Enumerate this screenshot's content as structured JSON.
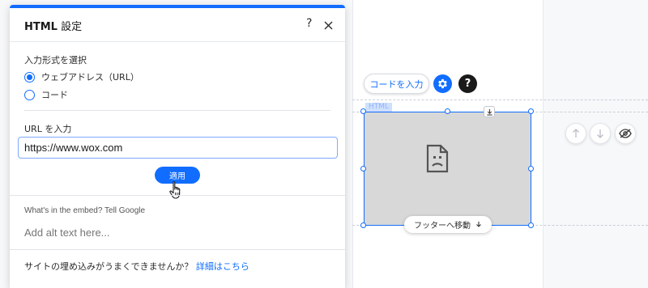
{
  "dialog": {
    "title_bold": "HTML",
    "title_rest": " 設定",
    "help_label": "?",
    "input_type_label": "入力形式を選択",
    "options": [
      {
        "label": "ウェブアドレス（URL）",
        "selected": true
      },
      {
        "label": "コード",
        "selected": false
      }
    ],
    "url_label": "URL を入力",
    "url_value": "https://www.wox.com",
    "apply_label": "適用",
    "alt_prompt": "What's in the embed? Tell Google",
    "alt_placeholder": "Add alt text here...",
    "trouble_text": "サイトの埋め込みがうまくできませんか？",
    "trouble_link": "詳細はこちら"
  },
  "canvas": {
    "code_button_label": "コードを入力",
    "help_label": "?",
    "element_tag": "HTML",
    "footer_button_label": "フッターへ移動"
  },
  "icons": {
    "close": "close-icon",
    "gear": "gear-icon",
    "broken_file": "broken-file-icon",
    "download": "download-icon",
    "arrow_up": "arrow-up-icon",
    "arrow_down": "arrow-down-icon",
    "eye_hidden": "eye-hidden-icon",
    "cursor": "hand-cursor-icon"
  },
  "colors": {
    "accent": "#116dff",
    "embed_fill": "#d8d8d8"
  }
}
